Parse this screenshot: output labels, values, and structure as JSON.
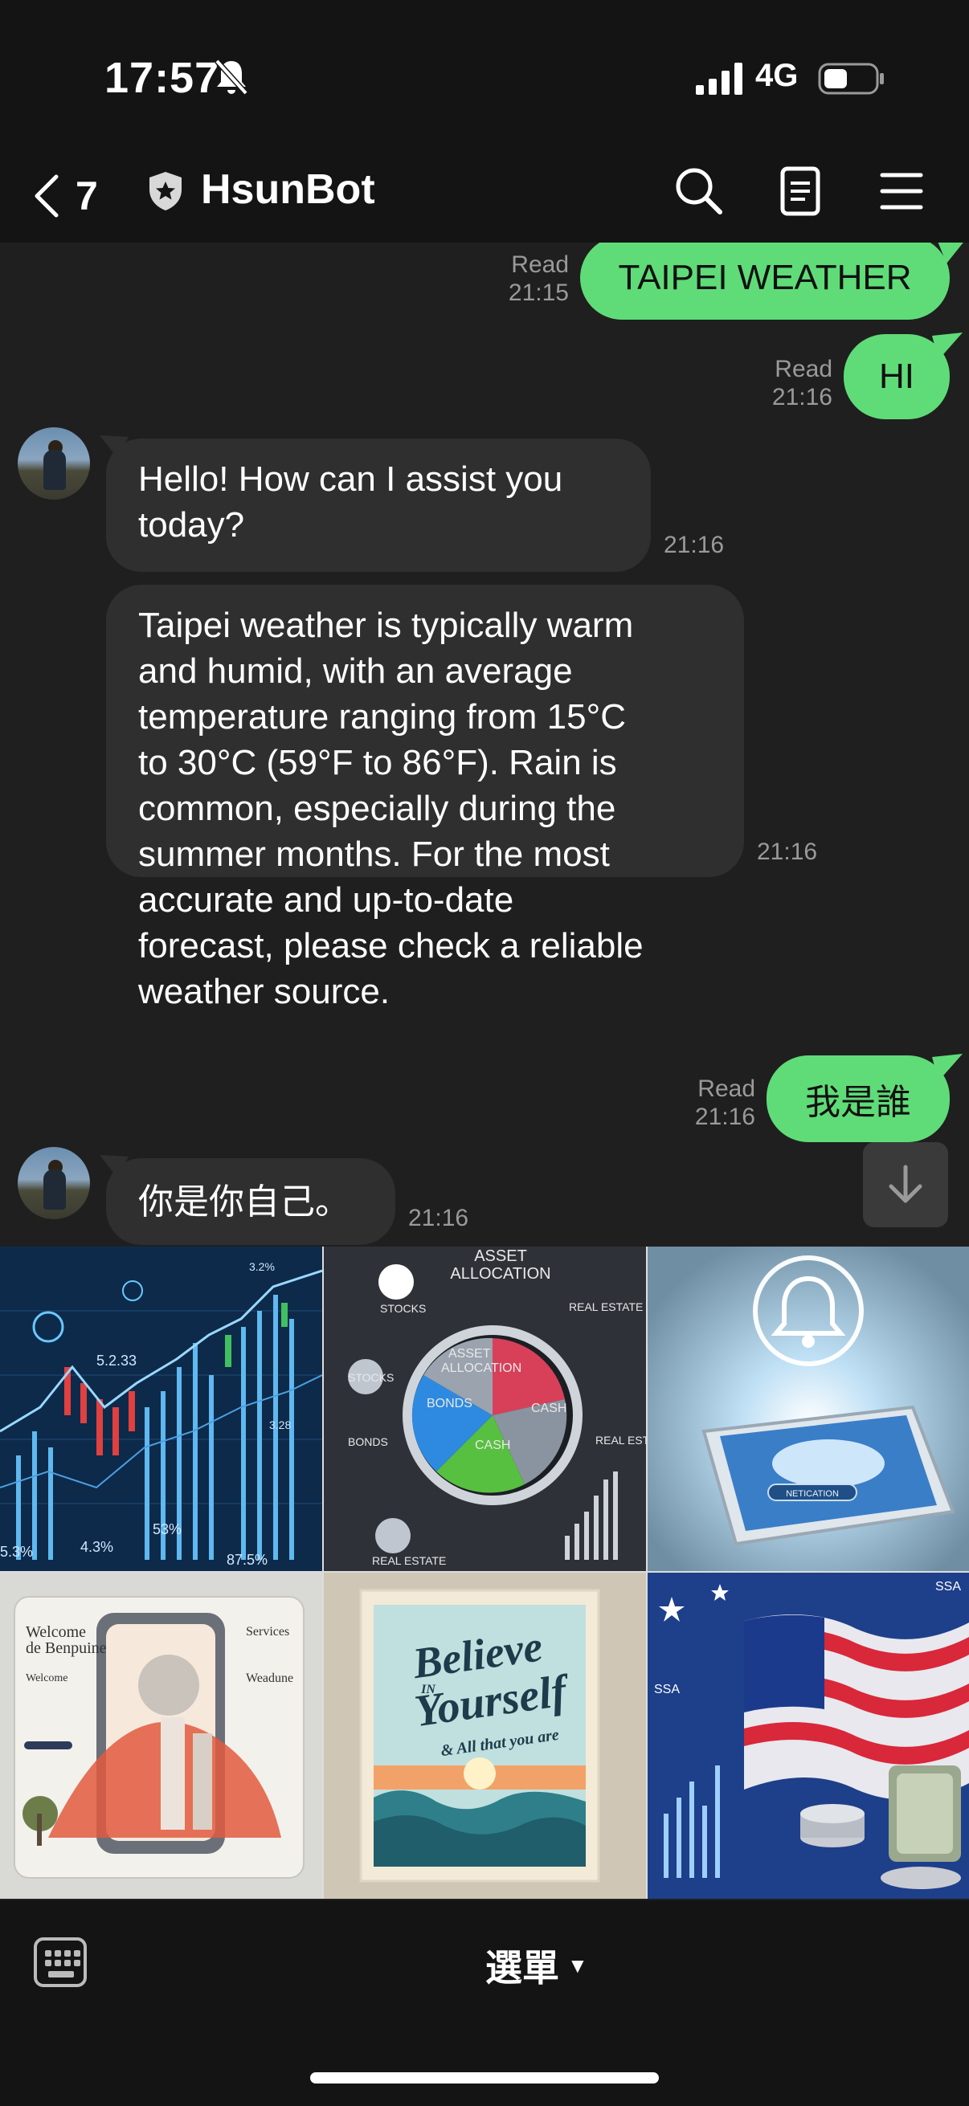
{
  "status_bar": {
    "time": "17:57",
    "network": "4G"
  },
  "header": {
    "back_count": "7",
    "title": "HsunBot"
  },
  "messages": {
    "m1": {
      "text": "TAIPEI WEATHER",
      "read": "Read",
      "time": "21:15"
    },
    "m2": {
      "text": "HI",
      "read": "Read",
      "time": "21:16"
    },
    "m3": {
      "lines": [
        "Hello! How can I assist you",
        "today?"
      ],
      "time": "21:16"
    },
    "m4": {
      "lines": [
        "Taipei weather is typically warm",
        "and humid, with an average",
        "temperature ranging from 15°C",
        "to 30°C (59°F to 86°F). Rain is",
        "common, especially during the",
        "summer months. For the most",
        "accurate and up-to-date",
        "forecast, please check a reliable",
        "weather source."
      ],
      "time": "21:16"
    },
    "m5": {
      "text": "我是誰",
      "read": "Read",
      "time": "21:16"
    },
    "m6": {
      "text": "你是你自己。",
      "time": "21:16"
    }
  },
  "images": {
    "t1": {
      "labels": [
        "5.2.33",
        "4.3%",
        "5.3%",
        "53%",
        "87.5%",
        "3.2%",
        "3.28"
      ]
    },
    "t2": {
      "title_line1": "ASSET",
      "title_line2": "ALLOCATION",
      "labels": [
        "STOCKS",
        "REAL ESTATE",
        "BONDS",
        "REAL ESTATE",
        "CASH",
        "BONDS",
        "CASH",
        "STOCKS",
        "REAL ESTATE",
        "ASSET",
        "ALLOCATION"
      ]
    },
    "t3": {
      "label": "NETICATION"
    },
    "t4": {
      "labels": [
        "Welcome",
        "de Benpuine",
        "Welcome",
        "Services",
        "Weadune"
      ]
    },
    "t5": {
      "lines": [
        "Believe",
        "IN",
        "Yourself",
        "& All that you are"
      ]
    },
    "t6": {
      "labels": [
        "SSA",
        "SSA"
      ]
    }
  },
  "bottom": {
    "menu_label": "選單",
    "menu_caret": "▼"
  },
  "colors": {
    "outgoing_bubble": "#5fdc78",
    "incoming_bubble": "#2f2f2f",
    "background": "#1f1f1f",
    "bar": "#141414"
  }
}
